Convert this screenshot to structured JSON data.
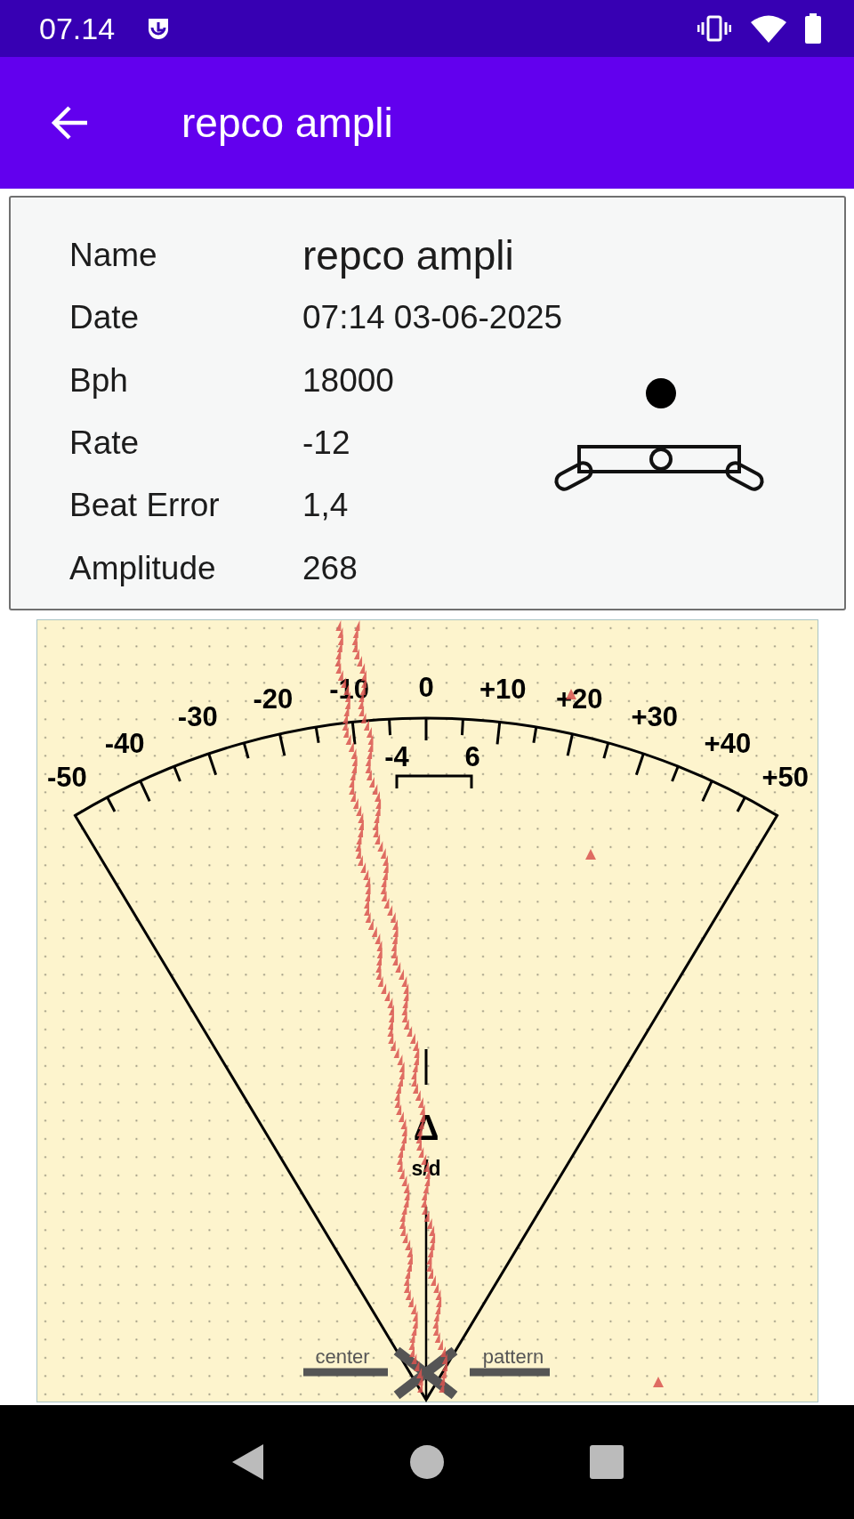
{
  "status_bar": {
    "time": "07.14"
  },
  "app_bar": {
    "title": "repco ampli"
  },
  "details": [
    {
      "label": "Name",
      "value": "repco ampli",
      "kind": "title"
    },
    {
      "label": "Date",
      "value": "07:14 03-06-2025",
      "kind": "plain"
    },
    {
      "label": "Bph",
      "value": "18000",
      "kind": "plain"
    },
    {
      "label": "Rate",
      "value": "-12",
      "kind": "plain"
    },
    {
      "label": "Beat Error",
      "value": "1,4",
      "kind": "plain"
    },
    {
      "label": "Amplitude",
      "value": "268",
      "kind": "plain"
    }
  ],
  "chart": {
    "scale_labels": [
      "-50",
      "-40",
      "-30",
      "-20",
      "-10",
      "0",
      "+10",
      "+20",
      "+30",
      "+40",
      "+50"
    ],
    "bracket_labels": [
      "-4",
      "6"
    ],
    "delta": "Δ",
    "unit": "s/d",
    "left_label": "center",
    "right_label": "pattern"
  }
}
